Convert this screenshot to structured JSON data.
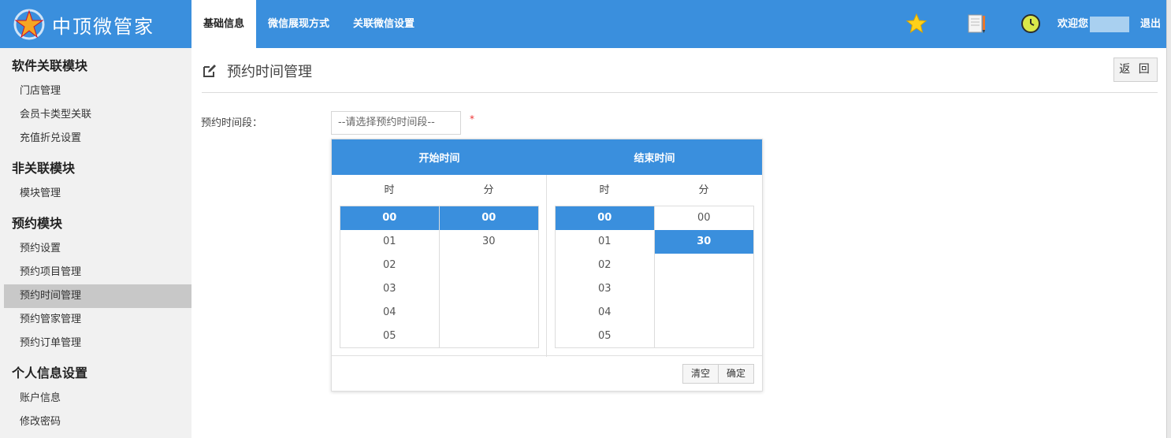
{
  "app": {
    "title": "中顶微管家"
  },
  "top_tabs": [
    {
      "label": "基础信息",
      "active": true
    },
    {
      "label": "微信展现方式",
      "active": false
    },
    {
      "label": "关联微信设置",
      "active": false
    }
  ],
  "header": {
    "welcome": "欢迎您",
    "logout": "退出"
  },
  "sidebar": {
    "groups": [
      {
        "title": "软件关联模块",
        "items": [
          "门店管理",
          "会员卡类型关联",
          "充值折兑设置"
        ]
      },
      {
        "title": "非关联模块",
        "items": [
          "模块管理"
        ]
      },
      {
        "title": "预约模块",
        "items": [
          "预约设置",
          "预约项目管理",
          "预约时间管理",
          "预约管家管理",
          "预约订单管理"
        ]
      },
      {
        "title": "个人信息设置",
        "items": [
          "账户信息",
          "修改密码"
        ]
      }
    ],
    "active_item": "预约时间管理"
  },
  "page": {
    "title": "预约时间管理",
    "back_label": "返 回",
    "field_label": "预约时间段：",
    "field_placeholder": "--请选择预约时间段--",
    "required_mark": "*"
  },
  "picker": {
    "start_title": "开始时间",
    "end_title": "结束时间",
    "hour_label": "时",
    "minute_label": "分",
    "hours": [
      "00",
      "01",
      "02",
      "03",
      "04",
      "05"
    ],
    "minutes": [
      "00",
      "30"
    ],
    "start_selected": {
      "hour": "00",
      "minute": "00"
    },
    "end_selected": {
      "hour": "00",
      "minute": "30"
    },
    "clear_label": "清空",
    "confirm_label": "确定"
  },
  "colors": {
    "primary": "#3a8fdd",
    "sidebar_bg": "#f1f1f1",
    "active_item_bg": "#c8c8c8",
    "required": "#ee3333"
  },
  "icons": {
    "logo": "star-logo-icon",
    "favorite": "star-icon",
    "notes": "notepad-icon",
    "history": "clock-history-icon",
    "edit": "edit-icon"
  }
}
